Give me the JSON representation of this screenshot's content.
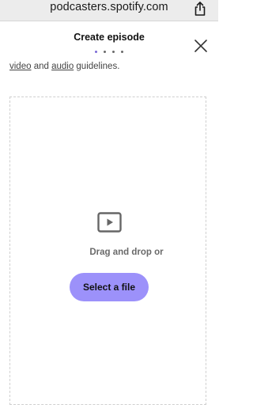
{
  "browser": {
    "url": "podcasters.spotify.com",
    "share_icon": "share-icon"
  },
  "header": {
    "title": "Create episode",
    "step_count": 4,
    "close_icon": "close-icon"
  },
  "guidelines": {
    "link_video": "video",
    "connector": " and ",
    "link_audio": "audio",
    "suffix": " guidelines."
  },
  "upload": {
    "icon": "video-icon",
    "drag_text": "Drag and drop or",
    "select_label": "Select a file"
  },
  "colors": {
    "accent": "#9c91fa",
    "dot_active": "#7a6ad6",
    "text_muted": "#6a6a6a"
  }
}
